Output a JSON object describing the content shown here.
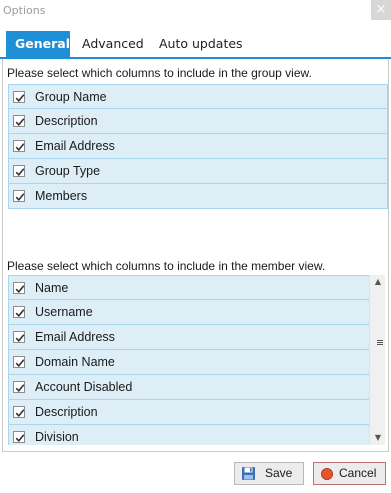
{
  "window": {
    "title": "Options",
    "close_glyph": "×"
  },
  "tabs": [
    {
      "label": "General",
      "active": true
    },
    {
      "label": "Advanced",
      "active": false
    },
    {
      "label": "Auto updates",
      "active": false
    }
  ],
  "group_view": {
    "prompt": "Please select which columns to include in the group view.",
    "items": [
      {
        "label": "Group Name",
        "checked": true
      },
      {
        "label": "Description",
        "checked": true
      },
      {
        "label": "Email Address",
        "checked": true
      },
      {
        "label": "Group Type",
        "checked": true
      },
      {
        "label": "Members",
        "checked": true
      }
    ]
  },
  "member_view": {
    "prompt": "Please select which columns to include in the member view.",
    "items": [
      {
        "label": "Name",
        "checked": true
      },
      {
        "label": "Username",
        "checked": true
      },
      {
        "label": "Email Address",
        "checked": true
      },
      {
        "label": "Domain Name",
        "checked": true
      },
      {
        "label": "Account Disabled",
        "checked": true
      },
      {
        "label": "Description",
        "checked": true
      },
      {
        "label": "Division",
        "checked": true
      }
    ]
  },
  "buttons": {
    "save_label": "Save",
    "save_icon": "save-disk-icon",
    "cancel_label": "Cancel",
    "cancel_icon": "cancel-circle-icon"
  },
  "colors": {
    "accent": "#1e8fd6",
    "row_bg": "#deeef7",
    "row_border": "#a9d6ef"
  }
}
